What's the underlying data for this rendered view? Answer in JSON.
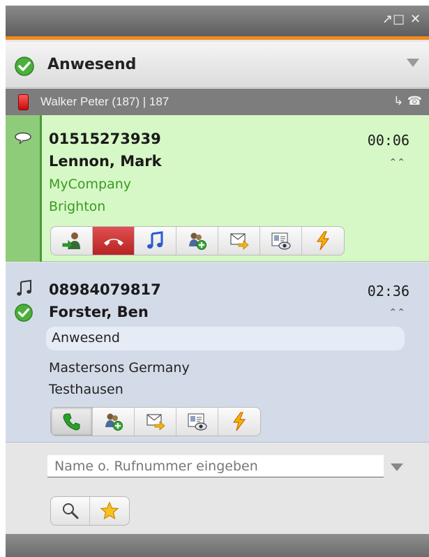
{
  "window": {
    "restore_glyph": "↗□",
    "close_glyph": "✕"
  },
  "status": {
    "label": "Anwesend",
    "icon": "check-circle-icon",
    "color": "#4caf3c"
  },
  "line": {
    "label": "Walker Peter (187) | 187",
    "icon": "red-phone-icon",
    "right_icons": "↳ ☎"
  },
  "calls": [
    {
      "state": "active",
      "number": "01515273939",
      "name": "Lennon, Mark",
      "company": "MyCompany",
      "city": "Brighton",
      "duration": "00:06",
      "text_color": "#3a9a22",
      "actions": [
        "transfer-icon",
        "hangup-icon",
        "music-hold-icon",
        "add-conference-icon",
        "forward-mail-icon",
        "view-contact-icon",
        "quick-action-icon"
      ]
    },
    {
      "state": "held",
      "number": "08984079817",
      "name": "Forster, Ben",
      "presence": "Anwesend",
      "company": "Mastersons Germany",
      "city": "Testhausen",
      "duration": "02:36",
      "text_color": "#222222",
      "actions": [
        "pickup-call-icon",
        "add-conference-icon",
        "forward-mail-icon",
        "view-contact-icon",
        "quick-action-icon"
      ]
    }
  ],
  "search": {
    "placeholder": "Name o. Rufnummer eingeben",
    "value": ""
  }
}
